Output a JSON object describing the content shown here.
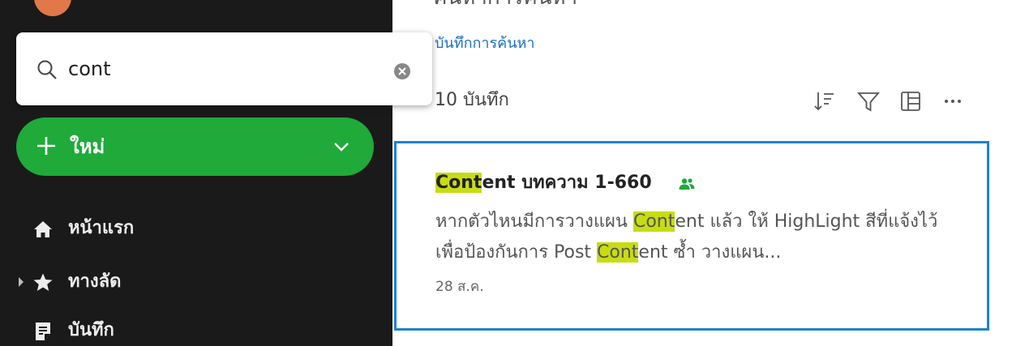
{
  "search": {
    "query": "cont",
    "highlight": "Cont",
    "highlight_color": "#c8dc14"
  },
  "sidebar": {
    "new_button": {
      "label": "ใหม่",
      "color": "#1faa3a"
    },
    "items": [
      {
        "label": "หน้าแรก",
        "icon": "home-icon"
      },
      {
        "label": "ทางลัด",
        "icon": "star-icon"
      },
      {
        "label": "บันทึก",
        "icon": "note-icon"
      }
    ]
  },
  "main": {
    "title_fragment": "ค้นหาการค้นหา",
    "saved_search_link": "บันทึกการค้นหา",
    "count_label": "10 บันทึก",
    "toolbar": [
      "sort-icon",
      "filter-icon",
      "view-icon",
      "more-icon"
    ]
  },
  "note": {
    "title_after_highlight": "ent บทความ 1-660",
    "snippet_part1": "หากตัวไหนมีการวางแผน ",
    "snippet_part2": "ent แล้ว ให้ HighLight สีที่แจ้งไว้ เพื่อป้องกันการ Post ",
    "snippet_part3": "ent ซ้ำ วางแผน...",
    "date": "28 ส.ค.",
    "shared": true,
    "border_color": "#1e82d2"
  }
}
